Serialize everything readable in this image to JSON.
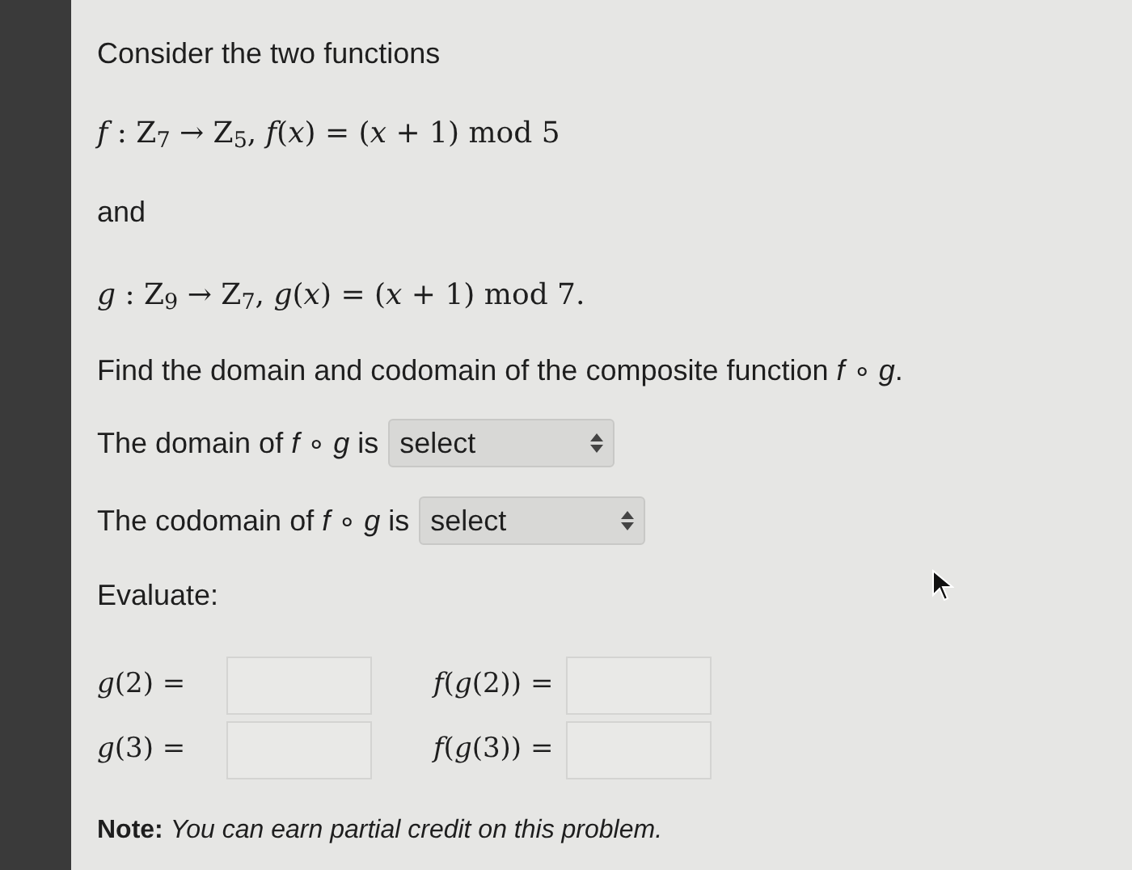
{
  "intro": "Consider the two functions",
  "formula_1": "*f* : Z$_{7}$ → Z$_{5}$, *f*(*x*) = (*x* + 1) mod 5",
  "connector": "and",
  "formula_2": "*g* : Z$_{9}$ → Z$_{7}$, *g*(*x*) = (*x* + 1) mod 7.",
  "question": "Find the domain and codomain of the composite function *f* ∘ *g*.",
  "selects": [
    {
      "label": "The domain of *f* ∘ *g* is",
      "value": "select"
    },
    {
      "label": "The codomain of *f* ∘ *g* is",
      "value": "select"
    }
  ],
  "evaluate_heading": "Evaluate:",
  "answers": [
    {
      "label": "*g*(2) ="
    },
    {
      "label": "*f*(*g*(2)) ="
    },
    {
      "label": "*g*(3) ="
    },
    {
      "label": "*f*(*g*(3)) ="
    }
  ],
  "note": "**Note:** *You can earn partial credit on this problem.*"
}
